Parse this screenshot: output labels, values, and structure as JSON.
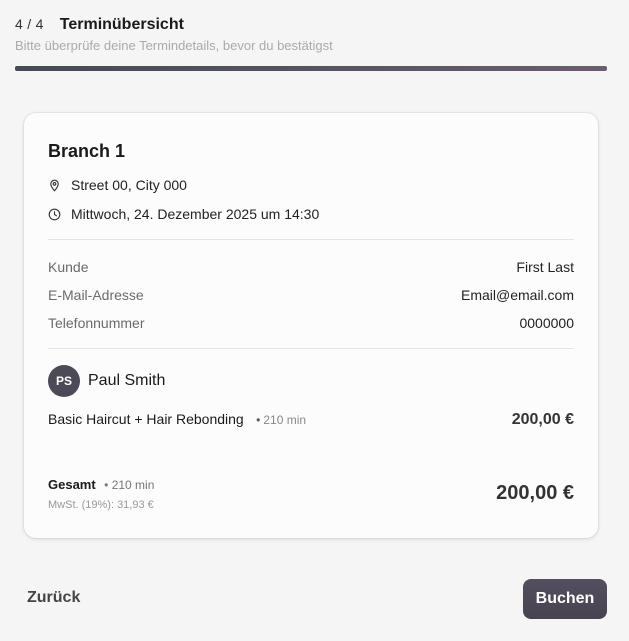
{
  "header": {
    "step": "4 / 4",
    "title": "Terminübersicht",
    "subtitle": "Bitte überprüfe deine Termindetails, bevor du bestätigst",
    "progress_percent": 100
  },
  "booking": {
    "branch": "Branch 1",
    "address": "Street 00, City 000",
    "datetime": "Mittwoch, 24. Dezember 2025 um 14:30",
    "customer_label": "Kunde",
    "customer_value": "First Last",
    "email_label": "E-Mail-Adresse",
    "email_value": "Email@email.com",
    "phone_label": "Telefonnummer",
    "phone_value": "0000000",
    "staff_initials": "PS",
    "staff_name": "Paul Smith",
    "service_name": "Basic Haircut + Hair Rebonding",
    "service_duration": "210 min",
    "service_price": "200,00 €",
    "total_label": "Gesamt",
    "total_duration": "210 min",
    "vat": "MwSt. (19%): 31,93 €",
    "total_price": "200,00 €"
  },
  "actions": {
    "back_label": "Zurück",
    "book_label": "Buchen"
  },
  "colors": {
    "accent": "#4d4a58",
    "progress": "#5a5563"
  },
  "icons": {
    "address": "map-pin-icon",
    "datetime": "clock-icon"
  }
}
